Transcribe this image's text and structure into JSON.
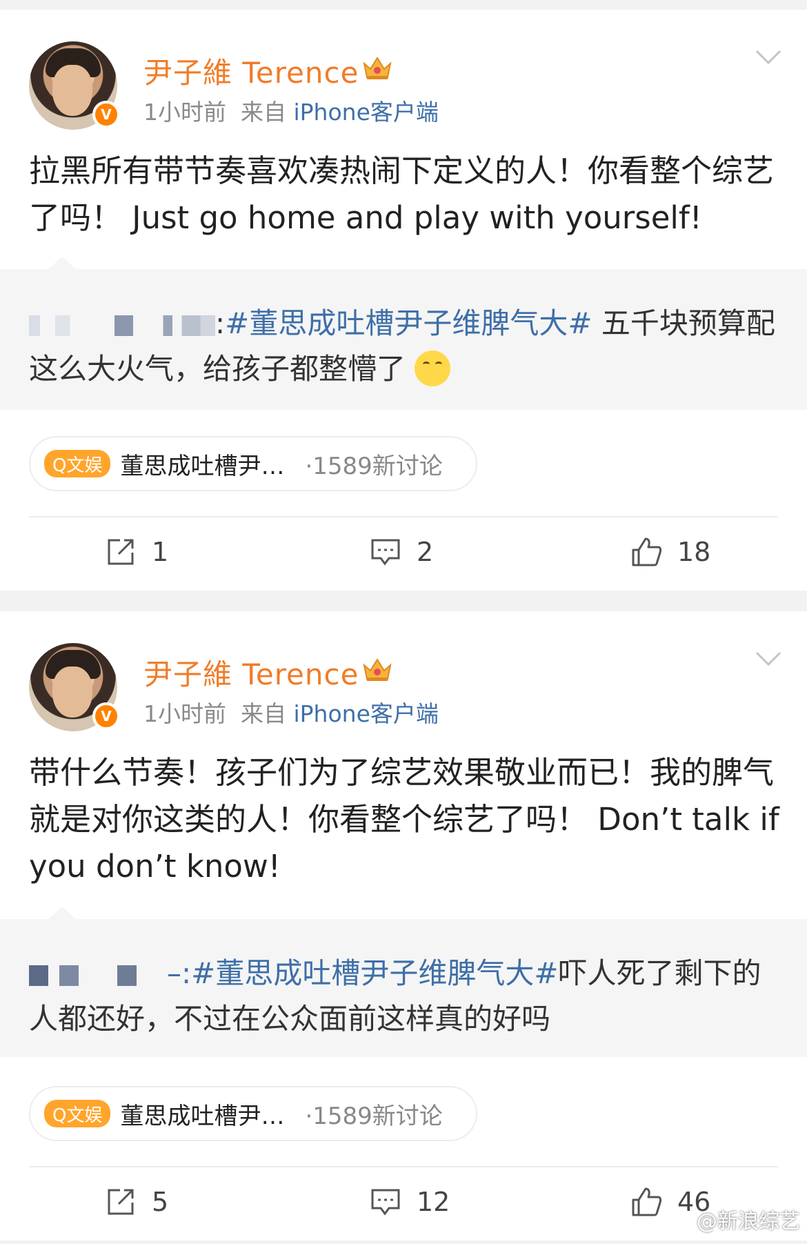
{
  "posts": [
    {
      "username": "尹子維 Terence",
      "time": "1小时前",
      "source_prefix": "来自",
      "source": "iPhone客户端",
      "text": "拉黑所有带节奏喜欢凑热闹下定义的人！你看整个综艺了吗！ Just go home and play with yourself!",
      "quote_prefix": ":",
      "quote_tag": "#董思成吐槽尹子维脾气大#",
      "quote_text": " 五千块预算配这么大火气，给孩子都整懵了",
      "topic_pill": "Q文娱",
      "topic_name": "董思成吐槽尹…",
      "topic_count": "·1589新讨论",
      "reposts": "1",
      "comments": "2",
      "likes": "18"
    },
    {
      "username": "尹子維 Terence",
      "time": "1小时前",
      "source_prefix": "来自",
      "source": "iPhone客户端",
      "text": "带什么节奏！孩子们为了综艺效果敬业而已！我的脾气就是对你这类的人！你看整个综艺了吗！ Don’t talk if you don’t know!",
      "quote_prefix": "–:",
      "quote_tag": "#董思成吐槽尹子维脾气大#",
      "quote_text": "吓人死了剩下的人都还好，不过在公众面前这样真的好吗",
      "topic_pill": "Q文娱",
      "topic_name": "董思成吐槽尹…",
      "topic_count": "·1589新讨论",
      "reposts": "5",
      "comments": "12",
      "likes": "46"
    }
  ],
  "watermark": "@新浪综艺",
  "colors": {
    "username": "#f07c28",
    "link": "#3e6fa8",
    "badge": "#ff8200",
    "topic_pill": "#ffa52b"
  },
  "icons": [
    "verified-badge-icon",
    "crown-icon",
    "chevron-down-icon",
    "repost-icon",
    "comment-icon",
    "like-icon",
    "weibo-logo-icon",
    "emoji-thinking-icon"
  ]
}
